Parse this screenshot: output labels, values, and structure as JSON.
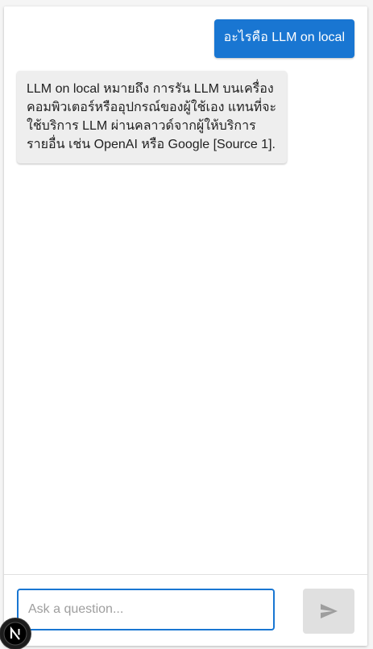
{
  "chat": {
    "messages": [
      {
        "role": "user",
        "text": "อะไรคือ LLM on local"
      },
      {
        "role": "assistant",
        "text": "LLM on local หมายถึง การรัน LLM บนเครื่องคอมพิวเตอร์หรืออุปกรณ์ของผู้ใช้เอง แทนที่จะใช้บริการ LLM ผ่านคลาวด์จากผู้ให้บริการรายอื่น เช่น OpenAI หรือ Google [Source 1]."
      }
    ]
  },
  "input": {
    "placeholder": "Ask a question...",
    "value": ""
  },
  "send_button": {
    "icon": "send-icon",
    "enabled": false
  },
  "badge": {
    "icon": "nextjs-logo-icon",
    "letter": "N"
  },
  "colors": {
    "accent": "#1976d2",
    "assistant_bubble": "#eeeeee",
    "disabled_button": "#e0e0e0"
  }
}
